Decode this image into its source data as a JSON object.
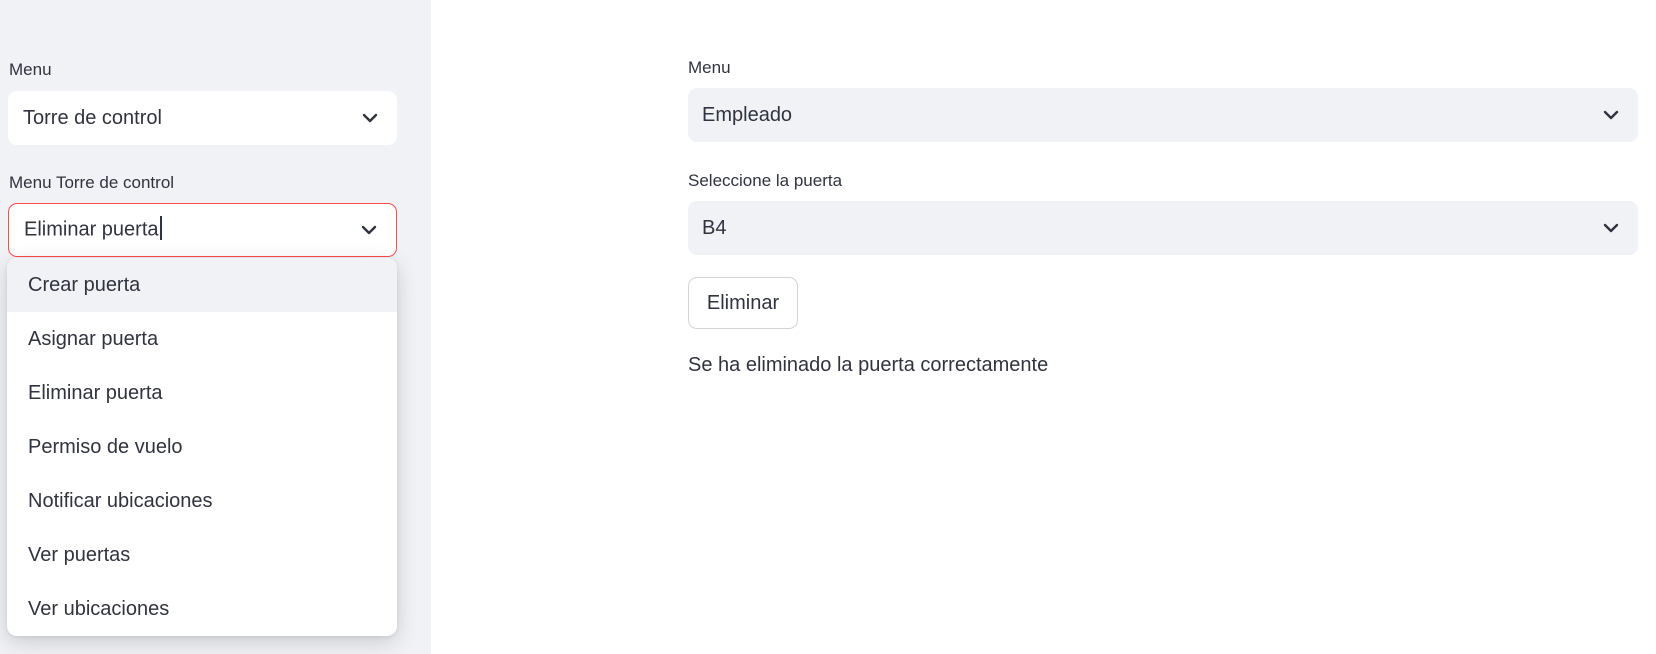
{
  "sidebar": {
    "menu_label": "Menu",
    "menu_value": "Torre de control",
    "submenu_label": "Menu Torre de control",
    "submenu_value": "Eliminar puerta",
    "options": [
      "Crear puerta",
      "Asignar puerta",
      "Eliminar puerta",
      "Permiso de vuelo",
      "Notificar ubicaciones",
      "Ver puertas",
      "Ver ubicaciones"
    ]
  },
  "main": {
    "menu_label": "Menu",
    "menu_value": "Empleado",
    "gate_label": "Seleccione la puerta",
    "gate_value": "B4",
    "delete_button": "Eliminar",
    "success_message": "Se ha eliminado la puerta correctamente"
  },
  "icons": {
    "dropdown": "chevron-down-icon"
  },
  "colors": {
    "focus_border": "#ff4b4b",
    "sidebar_bg": "#f0f2f6",
    "text": "#31333f"
  }
}
